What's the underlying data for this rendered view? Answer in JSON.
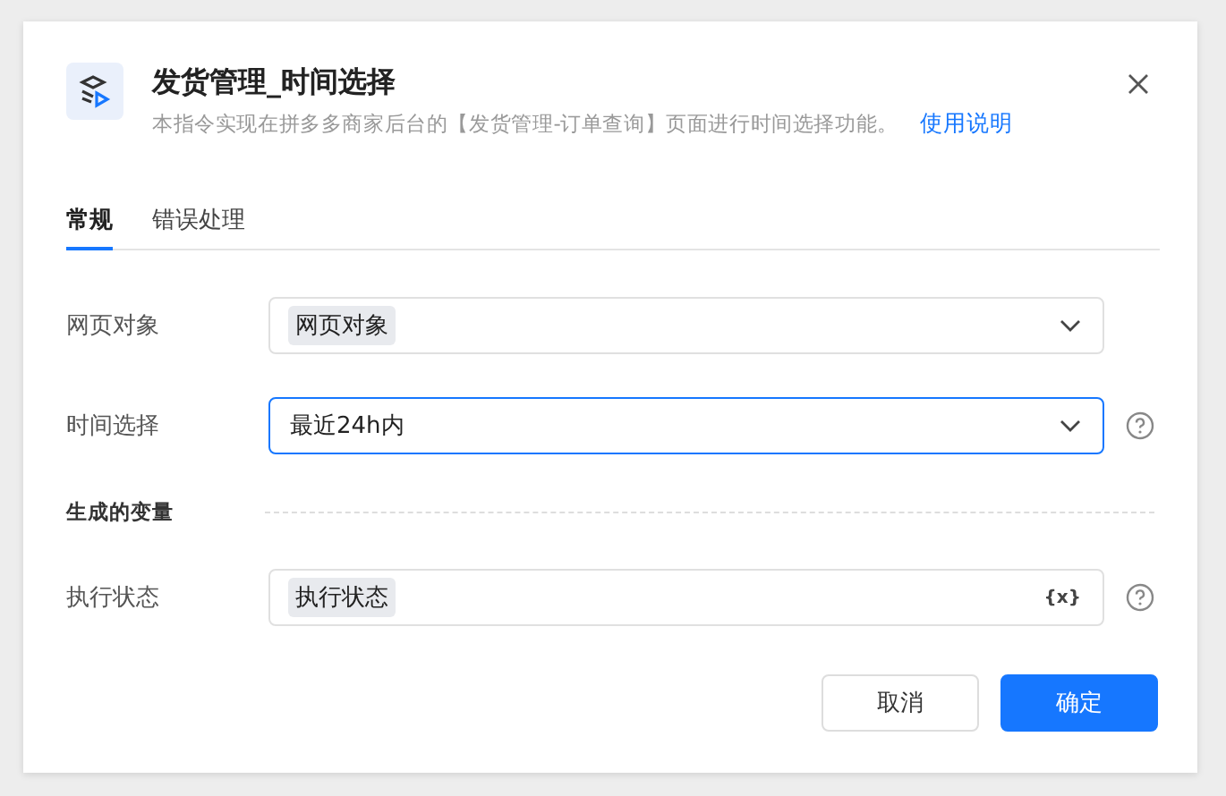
{
  "dialog": {
    "title": "发货管理_时间选择",
    "description": "本指令实现在拼多多商家后台的【发货管理-订单查询】页面进行时间选择功能。",
    "help_link": "使用说明"
  },
  "tabs": [
    {
      "label": "常规",
      "selected": true
    },
    {
      "label": "错误处理",
      "selected": false
    }
  ],
  "fields": [
    {
      "label": "网页对象",
      "kind": "select",
      "value": "网页对象",
      "tag": true,
      "focused": false,
      "help": false
    },
    {
      "label": "时间选择",
      "kind": "select",
      "value": "最近24h内",
      "tag": false,
      "focused": true,
      "help": true
    },
    {
      "kind": "section",
      "label": "生成的变量"
    },
    {
      "label": "执行状态",
      "kind": "variable",
      "value": "执行状态",
      "tag": true,
      "focused": false,
      "help": true,
      "variable_icon": "{x}"
    }
  ],
  "buttons": [
    {
      "label": "取消",
      "kind": "secondary"
    },
    {
      "label": "确定",
      "kind": "primary"
    }
  ]
}
